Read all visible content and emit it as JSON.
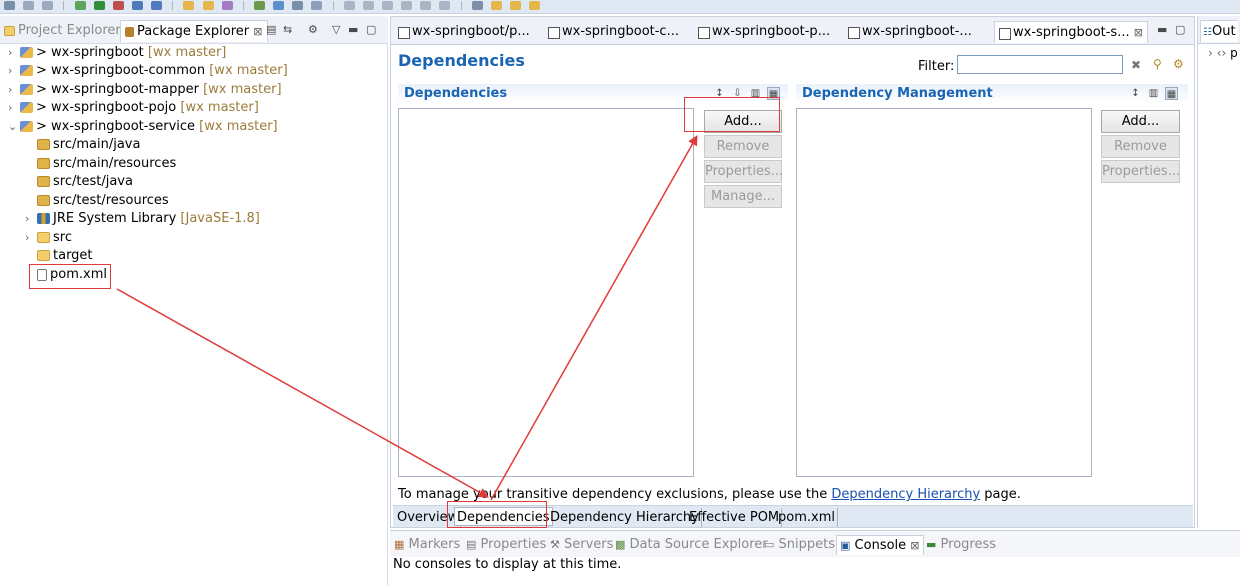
{
  "left_panel": {
    "tabs": [
      {
        "label": "Project Explorer",
        "active": false
      },
      {
        "label": "Package Explorer",
        "active": true
      }
    ],
    "close_glyph": "⊠",
    "tree": [
      {
        "label": "> wx-springboot",
        "branch": "[wx master]",
        "icon": "project-icon",
        "expanded": false,
        "level": 0
      },
      {
        "label": "> wx-springboot-common",
        "branch": "[wx master]",
        "icon": "project-icon",
        "expanded": false,
        "level": 0
      },
      {
        "label": "> wx-springboot-mapper",
        "branch": "[wx master]",
        "icon": "project-icon",
        "expanded": false,
        "level": 0
      },
      {
        "label": "> wx-springboot-pojo",
        "branch": "[wx master]",
        "icon": "project-icon",
        "expanded": false,
        "level": 0
      },
      {
        "label": "> wx-springboot-service",
        "branch": "[wx master]",
        "icon": "project-icon",
        "expanded": true,
        "level": 0
      },
      {
        "label": "src/main/java",
        "icon": "source-folder-icon",
        "level": 1
      },
      {
        "label": "src/main/resources",
        "icon": "source-folder-icon",
        "level": 1
      },
      {
        "label": "src/test/java",
        "icon": "source-folder-icon",
        "level": 1
      },
      {
        "label": "src/test/resources",
        "icon": "source-folder-icon",
        "level": 1
      },
      {
        "label": "JRE System Library",
        "branch": "[JavaSE-1.8]",
        "icon": "library-icon",
        "level": 1
      },
      {
        "label": "src",
        "icon": "folder-icon",
        "level": 1
      },
      {
        "label": "target",
        "icon": "folder-icon",
        "level": 1
      },
      {
        "label": "pom.xml",
        "icon": "xml-file-icon",
        "level": 1
      }
    ]
  },
  "editor": {
    "tabs": [
      {
        "label": "wx-springboot/p...",
        "active": false
      },
      {
        "label": "wx-springboot-c...",
        "active": false
      },
      {
        "label": "wx-springboot-p...",
        "active": false
      },
      {
        "label": "wx-springboot-...",
        "active": false
      },
      {
        "label": "wx-springboot-s...",
        "active": true
      }
    ],
    "title": "Dependencies",
    "filter_label": "Filter:",
    "filter_value": "",
    "dependencies_section": {
      "title": "Dependencies",
      "buttons": [
        {
          "label": "Add...",
          "enabled": true
        },
        {
          "label": "Remove",
          "enabled": false
        },
        {
          "label": "Properties...",
          "enabled": false
        },
        {
          "label": "Manage...",
          "enabled": false
        }
      ]
    },
    "management_section": {
      "title": "Dependency Management",
      "buttons": [
        {
          "label": "Add...",
          "enabled": true
        },
        {
          "label": "Remove",
          "enabled": false
        },
        {
          "label": "Properties...",
          "enabled": false
        }
      ]
    },
    "info_prefix": "To manage your transitive dependency exclusions, please use the ",
    "info_link": "Dependency Hierarchy",
    "info_suffix": " page.",
    "bottom_tabs": [
      {
        "label": "Overview",
        "active": false
      },
      {
        "label": "Dependencies",
        "active": true
      },
      {
        "label": "Dependency Hierarchy",
        "active": false
      },
      {
        "label": "Effective POM",
        "active": false
      },
      {
        "label": "pom.xml",
        "active": false
      }
    ]
  },
  "right_panel": {
    "tab_label": "Out",
    "item": "p"
  },
  "console_panel": {
    "tabs": [
      {
        "label": "Markers",
        "active": false
      },
      {
        "label": "Properties",
        "active": false
      },
      {
        "label": "Servers",
        "active": false
      },
      {
        "label": "Data Source Explorer",
        "active": false
      },
      {
        "label": "Snippets",
        "active": false
      },
      {
        "label": "Console",
        "active": true
      },
      {
        "label": "Progress",
        "active": false
      }
    ],
    "message": "No consoles to display at this time."
  },
  "colors": {
    "accent": "#1a65b3",
    "annotation": "#e23a3a",
    "branch": "#9c7c3c"
  }
}
